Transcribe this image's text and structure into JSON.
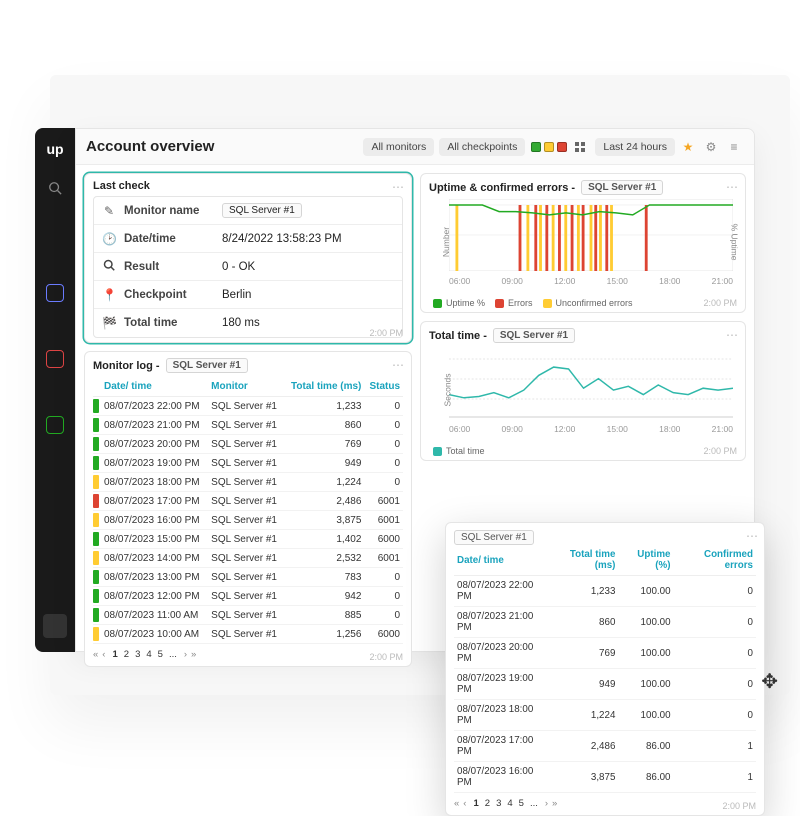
{
  "header": {
    "title": "Account overview",
    "all_monitors": "All monitors",
    "all_checkpoints": "All checkpoints",
    "time_range": "Last 24 hours"
  },
  "sidebar": {
    "logo_text": "up"
  },
  "last_check": {
    "title": "Last check",
    "rows": {
      "monitor_name": {
        "label": "Monitor name",
        "value": "SQL Server #1"
      },
      "datetime": {
        "label": "Date/time",
        "value": "8/24/2022 13:58:23 PM"
      },
      "result": {
        "label": "Result",
        "value": "0 - OK"
      },
      "checkpoint": {
        "label": "Checkpoint",
        "value": "Berlin"
      },
      "total_time": {
        "label": "Total time",
        "value": "180 ms"
      }
    },
    "timestamp": "2:00 PM"
  },
  "monitor_log": {
    "title": "Monitor log -",
    "monitor_chip": "SQL Server #1",
    "headers": {
      "dt": "Date/ time",
      "monitor": "Monitor",
      "total": "Total time (ms)",
      "status": "Status"
    },
    "rows": [
      {
        "status": "g",
        "dt": "08/07/2023 22:00 PM",
        "mon": "SQL Server #1",
        "total": "1,233",
        "st": "0"
      },
      {
        "status": "g",
        "dt": "08/07/2023 21:00 PM",
        "mon": "SQL Server #1",
        "total": "860",
        "st": "0"
      },
      {
        "status": "g",
        "dt": "08/07/2023 20:00 PM",
        "mon": "SQL Server #1",
        "total": "769",
        "st": "0"
      },
      {
        "status": "g",
        "dt": "08/07/2023 19:00 PM",
        "mon": "SQL Server #1",
        "total": "949",
        "st": "0"
      },
      {
        "status": "y",
        "dt": "08/07/2023 18:00 PM",
        "mon": "SQL Server #1",
        "total": "1,224",
        "st": "0"
      },
      {
        "status": "r",
        "dt": "08/07/2023 17:00 PM",
        "mon": "SQL Server #1",
        "total": "2,486",
        "st": "6001"
      },
      {
        "status": "y",
        "dt": "08/07/2023 16:00 PM",
        "mon": "SQL Server #1",
        "total": "3,875",
        "st": "6001"
      },
      {
        "status": "g",
        "dt": "08/07/2023 15:00 PM",
        "mon": "SQL Server #1",
        "total": "1,402",
        "st": "6000"
      },
      {
        "status": "y",
        "dt": "08/07/2023 14:00 PM",
        "mon": "SQL Server #1",
        "total": "2,532",
        "st": "6001"
      },
      {
        "status": "g",
        "dt": "08/07/2023 13:00 PM",
        "mon": "SQL Server #1",
        "total": "783",
        "st": "0"
      },
      {
        "status": "g",
        "dt": "08/07/2023 12:00 PM",
        "mon": "SQL Server #1",
        "total": "942",
        "st": "0"
      },
      {
        "status": "g",
        "dt": "08/07/2023 11:00 AM",
        "mon": "SQL Server #1",
        "total": "885",
        "st": "0"
      },
      {
        "status": "y",
        "dt": "08/07/2023 10:00 AM",
        "mon": "SQL Server #1",
        "total": "1,256",
        "st": "6000"
      }
    ],
    "timestamp": "2:00 PM"
  },
  "uptime_card": {
    "title": "Uptime & confirmed errors -",
    "monitor_chip": "SQL Server #1",
    "ylabel_left": "Number",
    "ylabel_right": "% Uptime",
    "legend": {
      "u": "Uptime %",
      "e": "Errors",
      "ue": "Unconfirmed errors"
    },
    "timestamp": "2:00 PM"
  },
  "total_time_card": {
    "title": "Total time -",
    "monitor_chip": "SQL Server #1",
    "ylabel_left": "Seconds",
    "legend_total": "Total time",
    "timestamp": "2:00 PM"
  },
  "floating": {
    "monitor_chip": "SQL Server #1",
    "headers": {
      "dt": "Date/ time",
      "total": "Total time (ms)",
      "uptime": "Uptime (%)",
      "confirmed": "Confirmed errors"
    },
    "rows": [
      {
        "dt": "08/07/2023 22:00 PM",
        "total": "1,233",
        "uptime": "100.00",
        "conf": "0"
      },
      {
        "dt": "08/07/2023 21:00 PM",
        "total": "860",
        "uptime": "100.00",
        "conf": "0"
      },
      {
        "dt": "08/07/2023 20:00 PM",
        "total": "769",
        "uptime": "100.00",
        "conf": "0"
      },
      {
        "dt": "08/07/2023 19:00 PM",
        "total": "949",
        "uptime": "100.00",
        "conf": "0"
      },
      {
        "dt": "08/07/2023 18:00 PM",
        "total": "1,224",
        "uptime": "100.00",
        "conf": "0"
      },
      {
        "dt": "08/07/2023 17:00 PM",
        "total": "2,486",
        "uptime": "86.00",
        "conf": "1"
      },
      {
        "dt": "08/07/2023 16:00 PM",
        "total": "3,875",
        "uptime": "86.00",
        "conf": "1"
      }
    ],
    "timestamp": "2:00 PM"
  },
  "pager": {
    "pages": [
      "1",
      "2",
      "3",
      "4",
      "5",
      "..."
    ]
  },
  "chart_data": [
    {
      "type": "bar",
      "title": "Uptime & confirmed errors - SQL Server #1",
      "xlabel": "",
      "ylabel": "Number",
      "y2label": "% Uptime",
      "xticks": [
        "06:00",
        "09:00",
        "12:00",
        "15:00",
        "18:00",
        "21:00"
      ],
      "ylim_left": [
        0,
        1
      ],
      "ylim_right": [
        0,
        100
      ],
      "series": [
        {
          "name": "Uptime %",
          "axis": "right",
          "type": "line",
          "color": "#2a2",
          "values": [
            100,
            100,
            100,
            90,
            90,
            88,
            85,
            88,
            85,
            90,
            88,
            85,
            100,
            100,
            100,
            100,
            100,
            100
          ]
        },
        {
          "name": "Errors",
          "axis": "left",
          "type": "bar",
          "color": "#d43",
          "x": [
            8.5,
            9.5,
            10.2,
            11,
            11.8,
            12.5,
            13.3,
            14,
            16.5
          ],
          "values": [
            1,
            1,
            1,
            1,
            1,
            1,
            1,
            1,
            1
          ]
        },
        {
          "name": "Unconfirmed errors",
          "axis": "left",
          "type": "bar",
          "color": "#fc3",
          "x": [
            4.5,
            9,
            9.8,
            10.6,
            11.4,
            12.2,
            13,
            13.6,
            14.3
          ],
          "values": [
            1,
            1,
            1,
            1,
            1,
            1,
            1,
            1,
            1
          ]
        }
      ]
    },
    {
      "type": "line",
      "title": "Total time - SQL Server #1",
      "xlabel": "",
      "ylabel": "Seconds",
      "xticks": [
        "06:00",
        "09:00",
        "12:00",
        "15:00",
        "18:00",
        "21:00"
      ],
      "ylim": [
        0,
        10
      ],
      "series": [
        {
          "name": "Total time",
          "color": "#2fb8aa",
          "x": [
            "04:00",
            "05:00",
            "06:00",
            "07:00",
            "08:00",
            "09:00",
            "10:00",
            "11:00",
            "12:00",
            "13:00",
            "14:00",
            "15:00",
            "16:00",
            "17:00",
            "18:00",
            "19:00",
            "20:00",
            "21:00",
            "22:00",
            "23:00"
          ],
          "values": [
            3.5,
            3.0,
            3.2,
            3.8,
            3.0,
            4.2,
            6.5,
            7.8,
            7.5,
            4.5,
            6.0,
            4.2,
            4.8,
            3.5,
            5.0,
            3.8,
            3.5,
            4.5,
            4.2,
            4.5
          ]
        }
      ]
    }
  ]
}
